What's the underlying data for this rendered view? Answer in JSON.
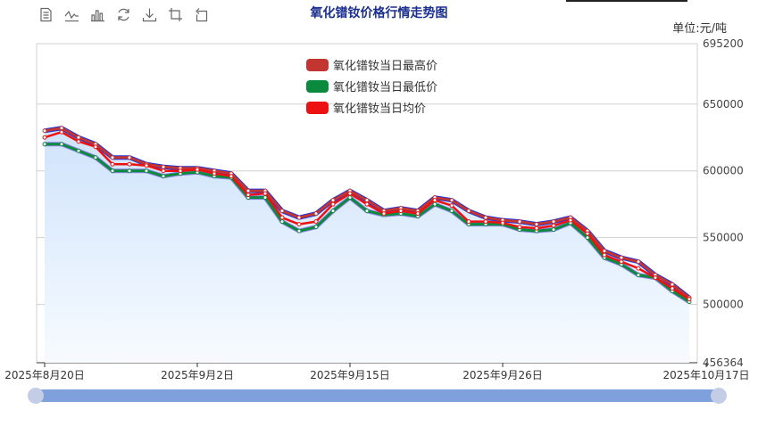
{
  "title": "氧化镨钕价格行情走势图",
  "unit": "单位:元/吨",
  "toolbar": [
    {
      "name": "data-view-icon"
    },
    {
      "name": "line-chart-icon"
    },
    {
      "name": "bar-chart-icon"
    },
    {
      "name": "restore-icon"
    },
    {
      "name": "save-image-icon"
    },
    {
      "name": "zoom-icon"
    },
    {
      "name": "zoom-reset-icon"
    }
  ],
  "colors": {
    "high": "#c23531",
    "low": "#0a8a3c",
    "avg": "#ee1111",
    "outline": "#2233dd",
    "low_outline": "#8f7fe8",
    "area_top": "#cfe3fb",
    "area_bottom": "#f7fbff",
    "grid": "#d0d0d0",
    "slider": "#7ea1db",
    "handle": "#c3cde6"
  },
  "chart_data": {
    "type": "line",
    "title": "氧化镨钕价格行情走势图",
    "ylabel": "单位:元/吨",
    "ylim": [
      456364,
      695200
    ],
    "y_ticks": [
      "695200",
      "650000",
      "600000",
      "550000",
      "500000",
      "456364"
    ],
    "y_tick_values": [
      695200,
      650000,
      600000,
      550000,
      500000,
      456364
    ],
    "x_tick_labels": [
      "2025年8月20日",
      "2025年9月2日",
      "2025年9月15日",
      "2025年9月26日",
      "2025年10月17日"
    ],
    "x_tick_index": [
      0,
      9,
      18,
      27,
      39
    ],
    "grid": true,
    "legend_position": "top-center",
    "series": [
      {
        "name": "氧化镨钕当日最高价",
        "values": [
          630000,
          632000,
          625000,
          620000,
          610000,
          610000,
          605000,
          603000,
          602000,
          602000,
          600000,
          598000,
          585000,
          585000,
          570000,
          565000,
          568000,
          578000,
          585000,
          578000,
          570000,
          572000,
          570000,
          580000,
          578000,
          570000,
          565000,
          563000,
          562000,
          560000,
          562000,
          565000,
          555000,
          540000,
          535000,
          532000,
          522000,
          515000,
          505000
        ]
      },
      {
        "name": "氧化镨钕当日最低价",
        "values": [
          620000,
          620000,
          615000,
          610000,
          600000,
          600000,
          600000,
          596000,
          598000,
          599000,
          596000,
          595000,
          580000,
          580000,
          562000,
          555000,
          558000,
          570000,
          580000,
          570000,
          567000,
          568000,
          566000,
          575000,
          570000,
          560000,
          560000,
          560000,
          556000,
          555000,
          556000,
          561000,
          550000,
          535000,
          530000,
          522000,
          520000,
          510000,
          502000
        ]
      },
      {
        "name": "氧化镨钕当日均价",
        "values": [
          625000,
          629000,
          622000,
          618000,
          605000,
          605000,
          604000,
          600000,
          600000,
          601000,
          598000,
          596000,
          582000,
          583000,
          565000,
          560000,
          562000,
          575000,
          583000,
          575000,
          568000,
          570000,
          568000,
          578000,
          574000,
          562000,
          562000,
          561000,
          558000,
          557000,
          559000,
          563000,
          553000,
          537000,
          532000,
          527000,
          520000,
          512000,
          504000
        ]
      }
    ]
  }
}
